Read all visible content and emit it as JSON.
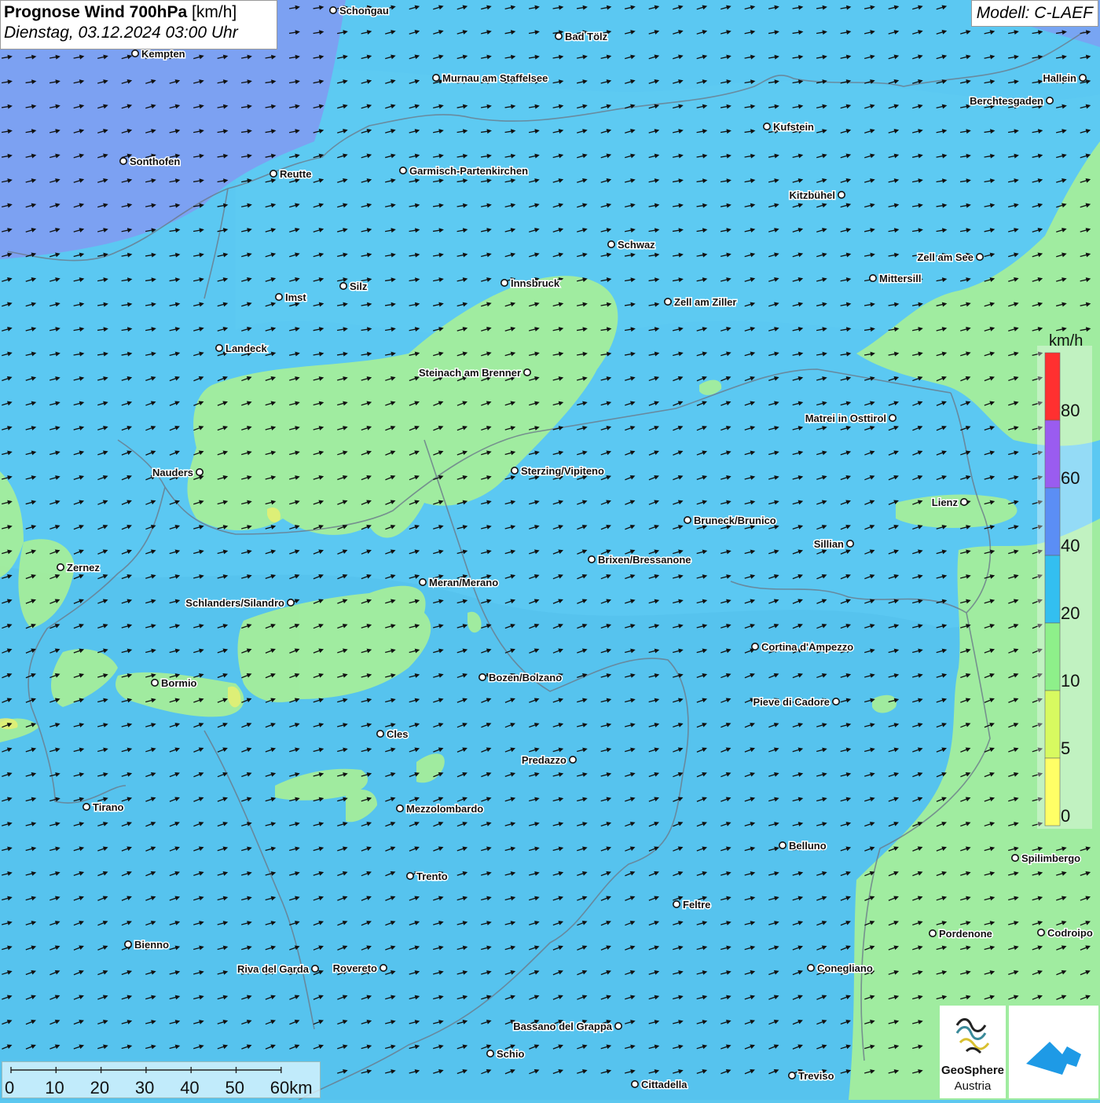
{
  "title": {
    "bold": "Prognose Wind 700hPa",
    "unit": "[km/h]",
    "datetime": "Dienstag, 03.12.2024 03:00 Uhr"
  },
  "model_label": "Modell: C-LAEF",
  "legend": {
    "unit": "km/h",
    "ticks": [
      "80",
      "60",
      "40",
      "20",
      "10",
      "5",
      "0"
    ],
    "colors": [
      "#ff3030",
      "#9a5cf0",
      "#5b8ef5",
      "#33bff0",
      "#8ef08a",
      "#d8fa60",
      "#ffff66"
    ]
  },
  "scale_bar": {
    "labels": [
      "0",
      "10",
      "20",
      "30",
      "40",
      "50",
      "60km"
    ]
  },
  "logos": {
    "geosphere_line1": "GeoSphere",
    "geosphere_line2": "Austria"
  },
  "colors": {
    "low_wind": "#a6ef9a",
    "mid_wind": "#5bc8f2",
    "high_wind": "#7f9cf2",
    "arrow": "#111111"
  },
  "places": [
    "Schongau",
    "Bad Tölz",
    "Kempten",
    "Murnau am Staffelsee",
    "Hallein",
    "Berchtesgaden",
    "Kufstein",
    "Sonthofen",
    "Reutte",
    "Garmisch-Partenkirchen",
    "Kitzbühel",
    "Schwaz",
    "Zell am See",
    "Mittersill",
    "Innsbruck",
    "Silz",
    "Imst",
    "Zell am Ziller",
    "Landeck",
    "Steinach am Brenner",
    "Matrei in Osttirol",
    "Nauders",
    "Sterzing/Vipiteno",
    "Lienz",
    "Bruneck/Brunico",
    "Sillian",
    "Brixen/Bressanone",
    "Zernez",
    "Meran/Merano",
    "Schlanders/Silandro",
    "Cortina d'Ampezzo",
    "Bozen/Bolzano",
    "Bormio",
    "Pieve di Cadore",
    "Cles",
    "Predazzo",
    "Tirano",
    "Mezzolombardo",
    "Belluno",
    "Spilimbergo",
    "Trento",
    "Feltre",
    "Pordenone",
    "Codroipo",
    "Bienno",
    "Riva del Garda",
    "Rovereto",
    "Conegliano",
    "Bassano del Grappa",
    "Schio",
    "Treviso",
    "Cittadella"
  ]
}
